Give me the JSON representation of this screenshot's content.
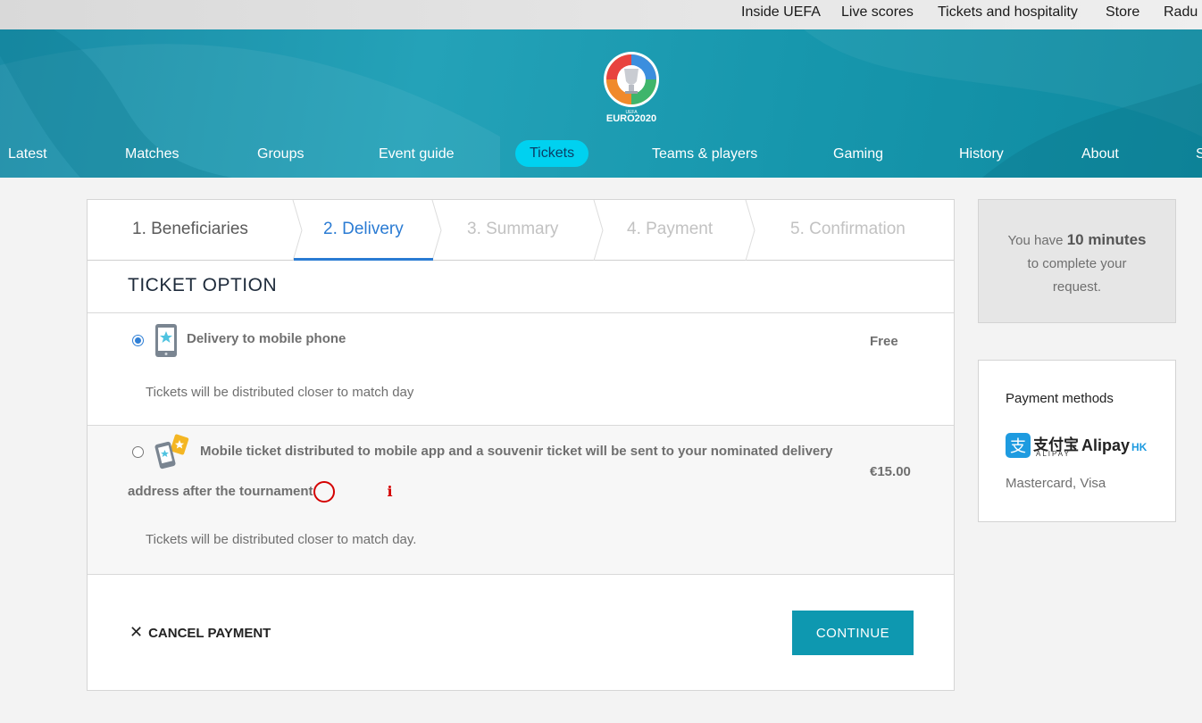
{
  "topbar": {
    "links": [
      "Inside UEFA",
      "Live scores",
      "Tickets and hospitality",
      "Store",
      "Radu"
    ]
  },
  "header": {
    "logo_text": "EURO2020",
    "logo_subtext": "UEFA",
    "nav": [
      "Latest",
      "Matches",
      "Groups",
      "Event guide",
      "Tickets",
      "Teams & players",
      "Gaming",
      "History",
      "About",
      "S"
    ],
    "active_nav": "Tickets"
  },
  "steps": [
    "1. Beneficiaries",
    "2. Delivery",
    "3. Summary",
    "4. Payment",
    "5. Confirmation"
  ],
  "current_step": "2. Delivery",
  "section_title": "TICKET OPTION",
  "options": [
    {
      "title": "Delivery to mobile phone",
      "price": "Free",
      "note": "Tickets will be distributed closer to match day",
      "selected": true,
      "icon": "mobile-phone-icon"
    },
    {
      "title": "Mobile ticket distributed to mobile app and a souvenir ticket will be sent to your nominated delivery address after the tournament",
      "title_line1": "Mobile ticket distributed to mobile app and a souvenir ticket will be sent to your nominated delivery",
      "title_line2": "address after the tournament",
      "price": "€15.00",
      "note": "Tickets will be distributed closer to match day.",
      "selected": false,
      "icon": "mobile-with-souvenir-ticket-icon"
    }
  ],
  "actions": {
    "cancel_label": "CANCEL PAYMENT",
    "continue_label": "CONTINUE"
  },
  "timer": {
    "prefix": "You have",
    "time": "10 minutes",
    "suffix": "to complete your request."
  },
  "payment": {
    "title": "Payment methods",
    "alipay_cn": "支付宝",
    "alipay_latin": "ALIPAY",
    "alipay_hk": "Alipay",
    "alipay_hk_suffix": "HK",
    "cards": "Mastercard, Visa"
  },
  "colors": {
    "header": "#1a8ca6",
    "active_tab": "#00d1f0",
    "step_active": "#2a7bd3",
    "continue_button": "#0e98b0",
    "info_icon": "#d40000"
  }
}
